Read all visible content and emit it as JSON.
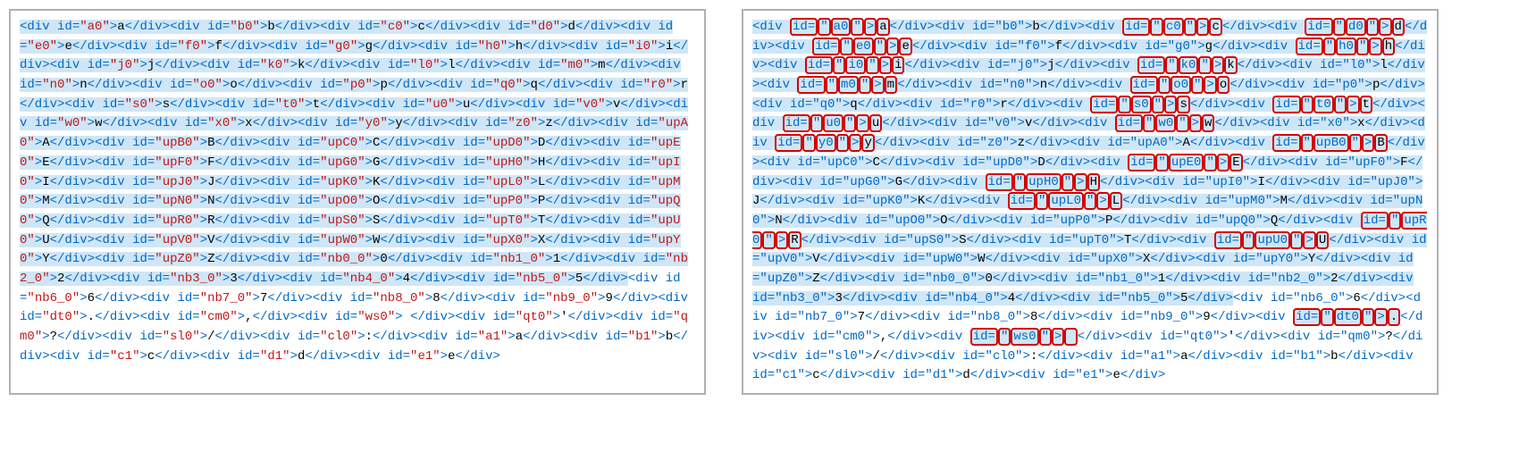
{
  "elements": [
    {
      "id": "a0",
      "ch": "a"
    },
    {
      "id": "b0",
      "ch": "b"
    },
    {
      "id": "c0",
      "ch": "c"
    },
    {
      "id": "d0",
      "ch": "d"
    },
    {
      "id": "e0",
      "ch": "e"
    },
    {
      "id": "f0",
      "ch": "f"
    },
    {
      "id": "g0",
      "ch": "g"
    },
    {
      "id": "h0",
      "ch": "h"
    },
    {
      "id": "i0",
      "ch": "i"
    },
    {
      "id": "j0",
      "ch": "j"
    },
    {
      "id": "k0",
      "ch": "k"
    },
    {
      "id": "l0",
      "ch": "l"
    },
    {
      "id": "m0",
      "ch": "m"
    },
    {
      "id": "n0",
      "ch": "n"
    },
    {
      "id": "o0",
      "ch": "o"
    },
    {
      "id": "p0",
      "ch": "p"
    },
    {
      "id": "q0",
      "ch": "q"
    },
    {
      "id": "r0",
      "ch": "r"
    },
    {
      "id": "s0",
      "ch": "s"
    },
    {
      "id": "t0",
      "ch": "t"
    },
    {
      "id": "u0",
      "ch": "u"
    },
    {
      "id": "v0",
      "ch": "v"
    },
    {
      "id": "w0",
      "ch": "w"
    },
    {
      "id": "x0",
      "ch": "x"
    },
    {
      "id": "y0",
      "ch": "y"
    },
    {
      "id": "z0",
      "ch": "z"
    },
    {
      "id": "upA0",
      "ch": "A"
    },
    {
      "id": "upB0",
      "ch": "B"
    },
    {
      "id": "upC0",
      "ch": "C"
    },
    {
      "id": "upD0",
      "ch": "D"
    },
    {
      "id": "upE0",
      "ch": "E"
    },
    {
      "id": "upF0",
      "ch": "F"
    },
    {
      "id": "upG0",
      "ch": "G"
    },
    {
      "id": "upH0",
      "ch": "H"
    },
    {
      "id": "upI0",
      "ch": "I"
    },
    {
      "id": "upJ0",
      "ch": "J"
    },
    {
      "id": "upK0",
      "ch": "K"
    },
    {
      "id": "upL0",
      "ch": "L"
    },
    {
      "id": "upM0",
      "ch": "M"
    },
    {
      "id": "upN0",
      "ch": "N"
    },
    {
      "id": "upO0",
      "ch": "O"
    },
    {
      "id": "upP0",
      "ch": "P"
    },
    {
      "id": "upQ0",
      "ch": "Q"
    },
    {
      "id": "upR0",
      "ch": "R"
    },
    {
      "id": "upS0",
      "ch": "S"
    },
    {
      "id": "upT0",
      "ch": "T"
    },
    {
      "id": "upU0",
      "ch": "U"
    },
    {
      "id": "upV0",
      "ch": "V"
    },
    {
      "id": "upW0",
      "ch": "W"
    },
    {
      "id": "upX0",
      "ch": "X"
    },
    {
      "id": "upY0",
      "ch": "Y"
    },
    {
      "id": "upZ0",
      "ch": "Z"
    },
    {
      "id": "nb0_0",
      "ch": "0"
    },
    {
      "id": "nb1_0",
      "ch": "1"
    },
    {
      "id": "nb2_0",
      "ch": "2"
    },
    {
      "id": "nb3_0",
      "ch": "3"
    },
    {
      "id": "nb4_0",
      "ch": "4"
    },
    {
      "id": "nb5_0",
      "ch": "5"
    },
    {
      "id": "nb6_0",
      "ch": "6"
    },
    {
      "id": "nb7_0",
      "ch": "7"
    },
    {
      "id": "nb8_0",
      "ch": "8"
    },
    {
      "id": "nb9_0",
      "ch": "9"
    },
    {
      "id": "dt0",
      "ch": "."
    },
    {
      "id": "cm0",
      "ch": ","
    },
    {
      "id": "ws0",
      "ch": "&nbsp;"
    },
    {
      "id": "qt0",
      "ch": "'"
    },
    {
      "id": "qm0",
      "ch": "?"
    },
    {
      "id": "sl0",
      "ch": "&#47;"
    },
    {
      "id": "cl0",
      "ch": ":"
    },
    {
      "id": "a1",
      "ch": "a"
    },
    {
      "id": "b1",
      "ch": "b"
    },
    {
      "id": "c1",
      "ch": "c"
    },
    {
      "id": "d1",
      "ch": "d"
    },
    {
      "id": "e1",
      "ch": "e"
    }
  ],
  "highlight_all_from": 0,
  "highlight_all_to": 57,
  "red_ids_left": [
    "a0",
    "b0",
    "c0",
    "d0",
    "e0",
    "f0",
    "g0",
    "h0",
    "i0",
    "j0",
    "k0",
    "l0",
    "m0",
    "n0",
    "o0",
    "p0",
    "q0",
    "r0",
    "s0",
    "t0",
    "u0",
    "v0",
    "w0",
    "x0",
    "y0",
    "z0",
    "upA0",
    "upB0",
    "upC0",
    "upD0",
    "upE0",
    "upF0",
    "upG0",
    "upH0",
    "upI0",
    "upJ0",
    "upK0",
    "upL0",
    "upM0",
    "upN0",
    "upO0",
    "upP0",
    "upQ0",
    "upR0",
    "upS0",
    "upT0",
    "upU0",
    "upV0",
    "upW0",
    "upX0",
    "upY0",
    "upZ0",
    "nb0_0",
    "nb1_0",
    "nb2_0",
    "nb3_0",
    "nb4_0",
    "nb5_0",
    "nb6_0",
    "nb7_0",
    "nb8_0",
    "nb9_0",
    "dt0",
    "cm0",
    "ws0",
    "qt0",
    "qm0",
    "sl0",
    "cl0",
    "a1",
    "b1",
    "c1",
    "d1",
    "e1"
  ],
  "boxed_ids_right": [
    "a0",
    "c0",
    "d0",
    "e0",
    "h0",
    "i0",
    "k0",
    "m0",
    "o0",
    "s0",
    "t0",
    "u0",
    "w0",
    "y0",
    "upB0",
    "upE0",
    "upH0",
    "upL0",
    "upR0",
    "upU0",
    "dt0",
    "ws0"
  ],
  "tokens": {
    "open_tag": "<div ",
    "id_attr": "id=",
    "q": "\"",
    "close_open": ">",
    "close_tag": "</div>"
  }
}
